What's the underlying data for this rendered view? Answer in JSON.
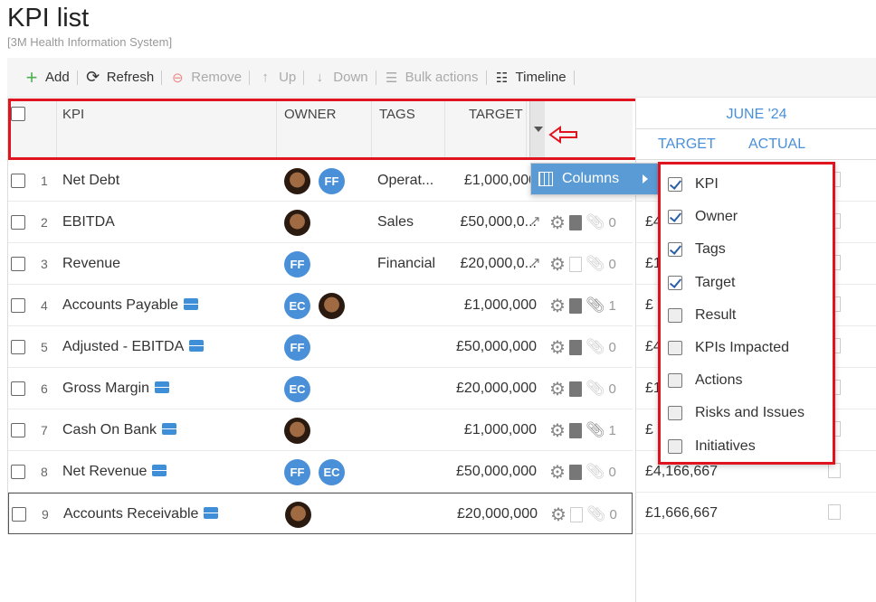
{
  "page": {
    "title": "KPI list",
    "subtitle": "[3M Health Information System]"
  },
  "toolbar": {
    "add": "Add",
    "refresh": "Refresh",
    "remove": "Remove",
    "up": "Up",
    "down": "Down",
    "bulk": "Bulk actions",
    "timeline": "Timeline"
  },
  "columns": {
    "kpi": "KPI",
    "owner": "OWNER",
    "tags": "TAGS",
    "target": "TARGET"
  },
  "period": {
    "month": "JUNE '24",
    "target": "TARGET",
    "actual": "ACTUAL"
  },
  "rows": [
    {
      "n": "1",
      "kpi": "Net Debt",
      "tags": "Operat...",
      "target": "£1,000,000",
      "clips": "",
      "rt": ""
    },
    {
      "n": "2",
      "kpi": "EBITDA",
      "tags": "Sales",
      "target": "£50,000,0...",
      "clips": "0",
      "rt": "£4"
    },
    {
      "n": "3",
      "kpi": "Revenue",
      "tags": "Financial",
      "target": "£20,000,0...",
      "clips": "0",
      "rt": "£1"
    },
    {
      "n": "4",
      "kpi": "Accounts Payable",
      "tags": "",
      "target": "£1,000,000",
      "clips": "1",
      "rt": "£"
    },
    {
      "n": "5",
      "kpi": "Adjusted - EBITDA",
      "tags": "",
      "target": "£50,000,000",
      "clips": "0",
      "rt": "£4"
    },
    {
      "n": "6",
      "kpi": "Gross Margin",
      "tags": "",
      "target": "£20,000,000",
      "clips": "0",
      "rt": "£1"
    },
    {
      "n": "7",
      "kpi": "Cash On Bank",
      "tags": "",
      "target": "£1,000,000",
      "clips": "1",
      "rt": "£"
    },
    {
      "n": "8",
      "kpi": "Net Revenue",
      "tags": "",
      "target": "£50,000,000",
      "clips": "0",
      "rt": "£4,166,667"
    },
    {
      "n": "9",
      "kpi": "Accounts Receivable",
      "tags": "",
      "target": "£20,000,000",
      "clips": "0",
      "rt": "£1,666,667"
    }
  ],
  "avatars": {
    "ff": "FF",
    "ec": "EC"
  },
  "menu": {
    "columns_label": "Columns",
    "items": [
      {
        "label": "KPI",
        "checked": true
      },
      {
        "label": "Owner",
        "checked": true
      },
      {
        "label": "Tags",
        "checked": true
      },
      {
        "label": "Target",
        "checked": true
      },
      {
        "label": "Result",
        "checked": false
      },
      {
        "label": "KPIs Impacted",
        "checked": false
      },
      {
        "label": "Actions",
        "checked": false
      },
      {
        "label": "Risks and Issues",
        "checked": false
      },
      {
        "label": "Initiatives",
        "checked": false
      }
    ]
  },
  "colors": {
    "accent": "#4a90d9",
    "highlight": "#e0141e",
    "menu_bg": "#5b9bd5"
  }
}
